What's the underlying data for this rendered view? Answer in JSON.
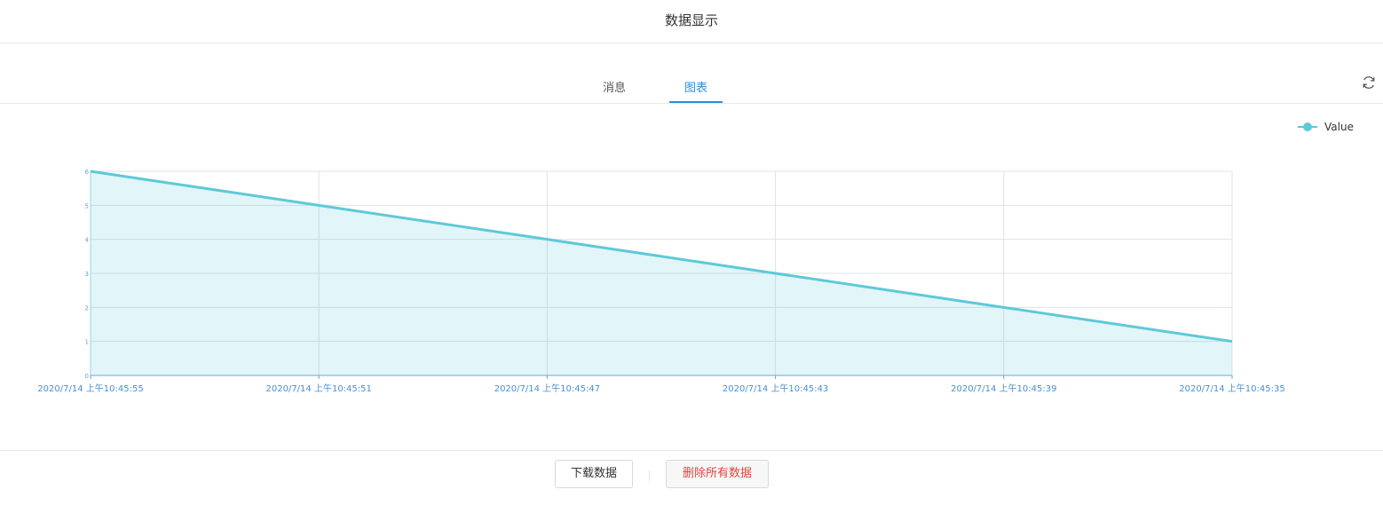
{
  "header": {
    "title": "数据显示"
  },
  "tabs": [
    {
      "label": "消息",
      "active": false
    },
    {
      "label": "图表",
      "active": true
    }
  ],
  "toolbar": {
    "refresh_icon": "refresh-icon"
  },
  "footer": {
    "download_label": "下载数据",
    "delete_label": "删除所有数据"
  },
  "colors": {
    "accent": "#2b90d9",
    "series": "#5ec9d8",
    "danger": "#e64340"
  },
  "chart_data": {
    "type": "area",
    "title": "",
    "xlabel": "",
    "ylabel": "",
    "categories": [
      "2020/7/14 上午10:45:55",
      "2020/7/14 上午10:45:51",
      "2020/7/14 上午10:45:47",
      "2020/7/14 上午10:45:43",
      "2020/7/14 上午10:45:39",
      "2020/7/14 上午10:45:35"
    ],
    "series": [
      {
        "name": "Value",
        "values": [
          6,
          5,
          4,
          3,
          2,
          1
        ]
      }
    ],
    "ylim": [
      0,
      6
    ],
    "yticks": [
      0,
      1,
      2,
      3,
      4,
      5,
      6
    ],
    "grid": true,
    "legend": "top-right"
  }
}
